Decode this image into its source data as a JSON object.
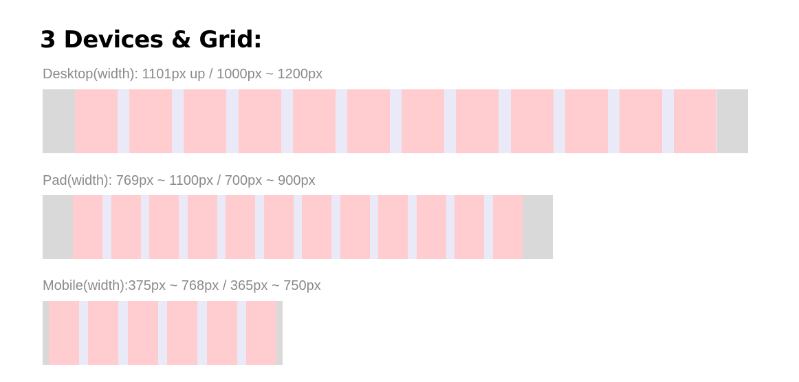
{
  "title": "3 Devices & Grid:",
  "devices": [
    {
      "name": "desktop",
      "label": "Desktop(width): 1101px up / 1000px ~ 1200px",
      "columns": 12
    },
    {
      "name": "pad",
      "label": "Pad(width): 769px ~ 1100px / 700px ~ 900px",
      "columns": 12
    },
    {
      "name": "mobile",
      "label": "Mobile(width):375px ~ 768px / 365px ~ 750px",
      "columns": 6
    }
  ],
  "colors": {
    "margin": "#d9d9d9",
    "gutter": "#e9e9f8",
    "column": "#ffcdcf",
    "label": "#8a8a8a",
    "title": "#000000"
  }
}
